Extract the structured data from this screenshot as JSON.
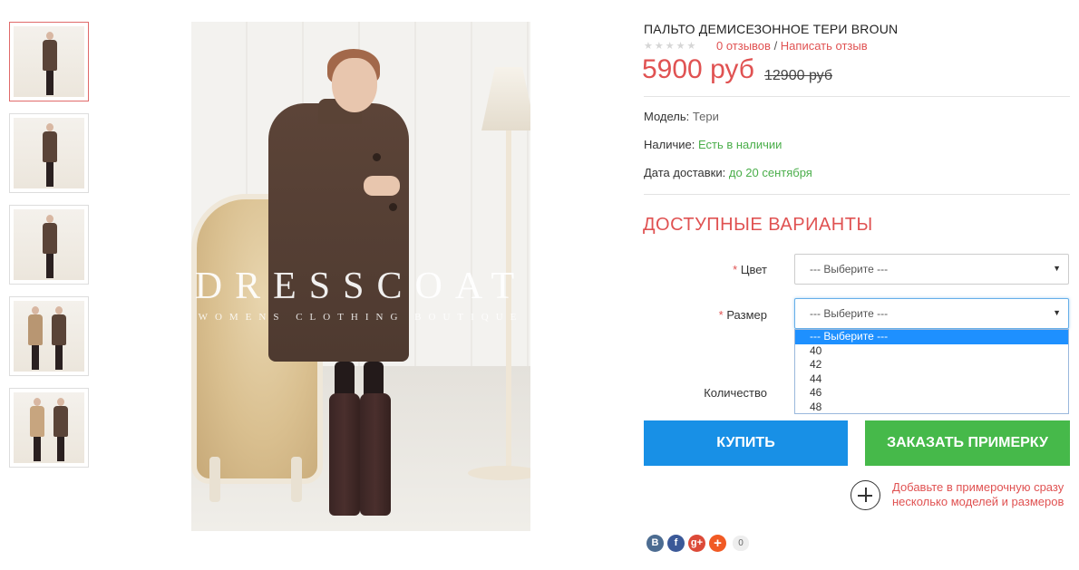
{
  "thumbnails": [
    {
      "label": "thumb-1",
      "active": true
    },
    {
      "label": "thumb-2",
      "active": false
    },
    {
      "label": "thumb-3",
      "active": false
    },
    {
      "label": "thumb-4",
      "active": false
    },
    {
      "label": "thumb-5",
      "active": false
    }
  ],
  "main_image": {
    "brand": "DRESSCOAT",
    "brand_sub": "WOMENS CLOTHING BOUTIQUE"
  },
  "product": {
    "title": "ПАЛЬТО ДЕМИСЕЗОННОЕ ТЕРИ BROUN",
    "stars": "★★★★★",
    "reviews_link": "0 отзывов",
    "reviews_sep": " / ",
    "write_review_link": "Написать отзыв",
    "price": "5900 руб",
    "old_price": "12900 руб"
  },
  "info": {
    "model_label": "Модель:",
    "model_value": "Тери",
    "availability_label": "Наличие:",
    "availability_value": "Есть в наличии",
    "delivery_label": "Дата доставки:",
    "delivery_value": "до 20 сентября"
  },
  "options": {
    "title": "ДОСТУПНЫЕ ВАРИАНТЫ",
    "required_mark": "*",
    "color_label": "Цвет",
    "color_value": "--- Выберите ---",
    "size_label": "Размер",
    "size_value": "--- Выберите ---",
    "size_options": [
      "--- Выберите ---",
      "40",
      "42",
      "44",
      "46",
      "48"
    ],
    "quantity_label": "Количество"
  },
  "actions": {
    "buy": "КУПИТЬ",
    "order_fitting": "ЗАКАЗАТЬ ПРИМЕРКУ",
    "add_fitting_text": "Добавьте в примерочную сразу несколько моделей и размеров"
  },
  "social": {
    "vk": "B",
    "fb": "f",
    "gplus": "g+",
    "more": "+",
    "count": "0"
  },
  "colors": {
    "accent_red": "#e05252",
    "buy_blue": "#1890e6",
    "fit_green": "#46b94a",
    "in_stock_green": "#4aae4a"
  }
}
